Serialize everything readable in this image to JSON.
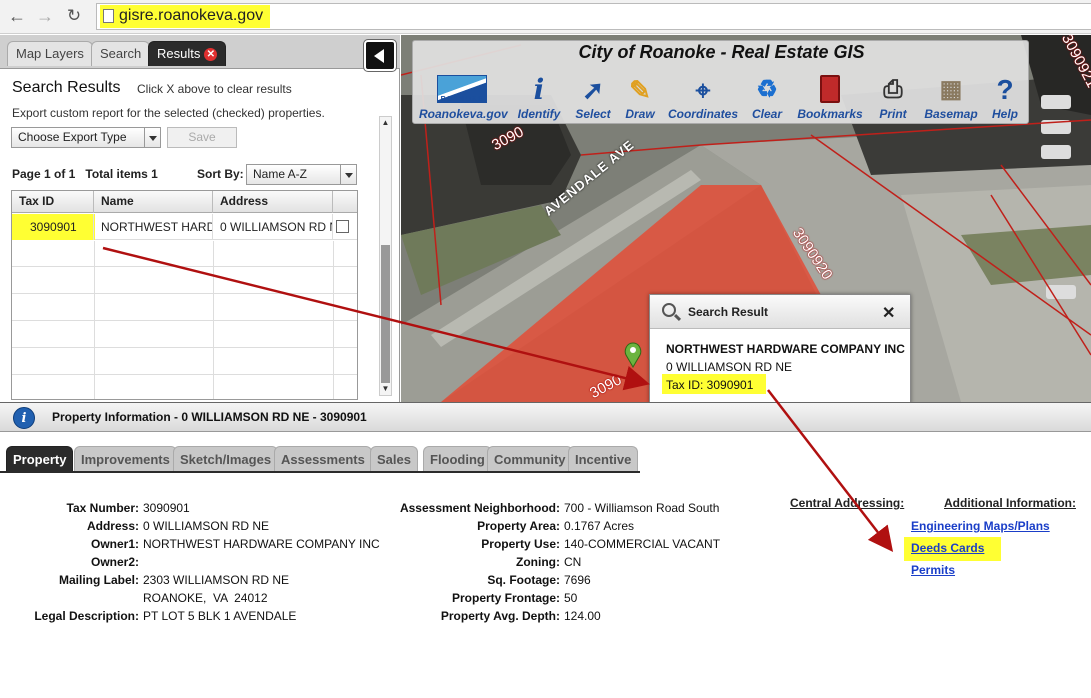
{
  "browser": {
    "url": "gisre.roanokeva.gov"
  },
  "left_panel": {
    "tabs": [
      {
        "label": "Map Layers"
      },
      {
        "label": "Search"
      },
      {
        "label": "Results"
      }
    ],
    "close_glyph": "✕",
    "title": "Search Results",
    "title_hint": "Click X above to clear results",
    "export_desc": "Export custom report for the selected (checked) properties.",
    "export_select": "Choose Export Type",
    "save_label": "Save",
    "page_info": "Page 1 of 1",
    "total_items": "Total items 1",
    "sort_label": "Sort By:",
    "sort_value": "Name A-Z",
    "columns": [
      "Tax ID",
      "Name",
      "Address"
    ],
    "rows": [
      {
        "tax_id": "3090901",
        "name": "NORTHWEST HARDWARE COMPANY INC",
        "address": "0 WILLIAMSON RD NE"
      }
    ]
  },
  "map": {
    "title": "City of Roanoke - Real Estate GIS",
    "logo_text": "ROANOKE",
    "tools": [
      {
        "label": "Roanokeva.gov",
        "icon": "roanoke-logo-icon"
      },
      {
        "label": "Identify",
        "icon": "info-icon"
      },
      {
        "label": "Select",
        "icon": "cursor-icon"
      },
      {
        "label": "Draw",
        "icon": "pencil-icon"
      },
      {
        "label": "Coordinates",
        "icon": "crosshair-icon"
      },
      {
        "label": "Clear",
        "icon": "recycle-bin-icon"
      },
      {
        "label": "Bookmarks",
        "icon": "bookmark-book-icon"
      },
      {
        "label": "Print",
        "icon": "printer-icon"
      },
      {
        "label": "Basemap",
        "icon": "basemap-icon"
      },
      {
        "label": "Help",
        "icon": "help-icon"
      }
    ],
    "street_label": "AVENDALE AVE",
    "parcel_labels": [
      "3090920",
      "3090",
      "3090",
      "3090921"
    ],
    "popup": {
      "title": "Search Result",
      "owner": "NORTHWEST HARDWARE COMPANY INC",
      "address": "0 WILLIAMSON RD NE",
      "tax_id": "Tax ID: 3090901"
    }
  },
  "info_bar": {
    "prefix": "Property Information - ",
    "title": "0 WILLIAMSON RD NE - 3090901"
  },
  "property_tabs": [
    "Property",
    "Improvements",
    "Sketch/Images",
    "Assessments",
    "Sales",
    "Flooding",
    "Community",
    "Incentive"
  ],
  "details_left": [
    {
      "label": "Tax Number:",
      "value": "3090901"
    },
    {
      "label": "Address:",
      "value": "0 WILLIAMSON RD NE"
    },
    {
      "label": "Owner1:",
      "value": "NORTHWEST HARDWARE COMPANY INC"
    },
    {
      "label": "Owner2:",
      "value": ""
    },
    {
      "label": "Mailing Label:",
      "value": "2303 WILLIAMSON RD NE"
    },
    {
      "label": "",
      "value": "ROANOKE,  VA  24012"
    },
    {
      "label": "Legal Description:",
      "value": "PT LOT 5 BLK 1 AVENDALE"
    }
  ],
  "details_right": [
    {
      "label": "Assessment Neighborhood:",
      "value": "700 - Williamson Road South"
    },
    {
      "label": "Property Area:",
      "value": "0.1767 Acres"
    },
    {
      "label": "Property Use:",
      "value": "140-COMMERCIAL VACANT"
    },
    {
      "label": "Zoning:",
      "value": "CN"
    },
    {
      "label": "Sq. Footage:",
      "value": "7696"
    },
    {
      "label": "Property Frontage:",
      "value": "50"
    },
    {
      "label": "Property Avg. Depth:",
      "value": "124.00"
    }
  ],
  "central_addressing": "Central Addressing:",
  "additional_info": {
    "label": "Additional Information:",
    "links": [
      "Engineering Maps/Plans",
      "Deeds Cards",
      "Permits"
    ]
  },
  "colors": {
    "highlight": "#ffff33",
    "arrow": "#b01010",
    "parcel": "#e0503a",
    "link": "#1a3ec8"
  }
}
